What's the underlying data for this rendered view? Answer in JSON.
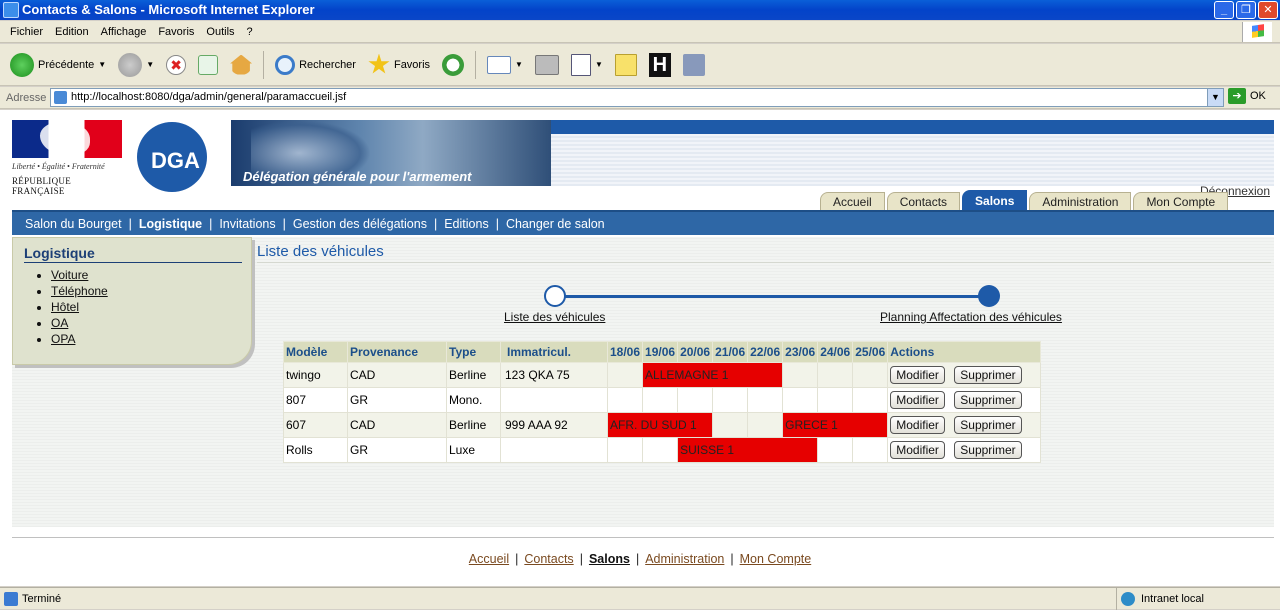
{
  "window": {
    "title": "Contacts & Salons - Microsoft Internet Explorer",
    "buttons": [
      "_",
      "❐",
      "✕"
    ]
  },
  "menu": [
    "Fichier",
    "Edition",
    "Affichage",
    "Favoris",
    "Outils",
    "?"
  ],
  "toolbar": {
    "back_label": "Précédente",
    "search_label": "Rechercher",
    "favorites_label": "Favoris"
  },
  "address": {
    "label": "Adresse",
    "url": "http://localhost:8080/dga/admin/general/paramaccueil.jsf",
    "go_label": "OK"
  },
  "banner": {
    "motto": "Liberté • Égalité • Fraternité",
    "republic": "RÉPUBLIQUE FRANÇAISE",
    "logo_text": "DGA",
    "tagline": "Délégation générale pour l'armement",
    "logout": "Déconnexion"
  },
  "tabs": [
    {
      "label": "Accueil",
      "active": false
    },
    {
      "label": "Contacts",
      "active": false
    },
    {
      "label": "Salons",
      "active": true
    },
    {
      "label": "Administration",
      "active": false
    },
    {
      "label": "Mon Compte",
      "active": false
    }
  ],
  "subnav": [
    {
      "label": "Salon du Bourget"
    },
    {
      "label": "Logistique",
      "active": true
    },
    {
      "label": "Invitations"
    },
    {
      "label": "Gestion des délégations"
    },
    {
      "label": "Editions"
    },
    {
      "label": "Changer de salon"
    }
  ],
  "sidebar": {
    "title": "Logistique",
    "items": [
      "Voiture",
      "Téléphone",
      "Hôtel",
      "OA",
      "OPA"
    ]
  },
  "content": {
    "title": "Liste des véhicules",
    "steps": [
      "Liste des véhicules",
      "Planning Affectation des véhicules"
    ]
  },
  "table": {
    "headers": [
      "Modèle",
      "Provenance",
      "Type",
      "Immatricul.",
      "18/06",
      "19/06",
      "20/06",
      "21/06",
      "22/06",
      "23/06",
      "24/06",
      "25/06",
      "Actions"
    ],
    "rows": [
      {
        "modele": "twingo",
        "provenance": "CAD",
        "type": "Berline",
        "immat": "123 QKA 75",
        "assignment": "ALLEMAGNE 1"
      },
      {
        "modele": "807",
        "provenance": "GR",
        "type": "Mono.",
        "immat": ""
      },
      {
        "modele": "607",
        "provenance": "CAD",
        "type": "Berline",
        "immat": "999 AAA 92",
        "assignment": "AFR. DU SUD 1",
        "assignment2": "GRECE 1"
      },
      {
        "modele": "Rolls",
        "provenance": "GR",
        "type": "Luxe",
        "immat": "",
        "assignment": "SUISSE 1"
      }
    ],
    "modify_label": "Modifier",
    "delete_label": "Supprimer",
    "highlight_color": "#e60000"
  },
  "footer": [
    "Accueil",
    "Contacts",
    "Salons",
    "Administration",
    "Mon Compte"
  ],
  "status": {
    "left": "Terminé",
    "zone": "Intranet local"
  }
}
